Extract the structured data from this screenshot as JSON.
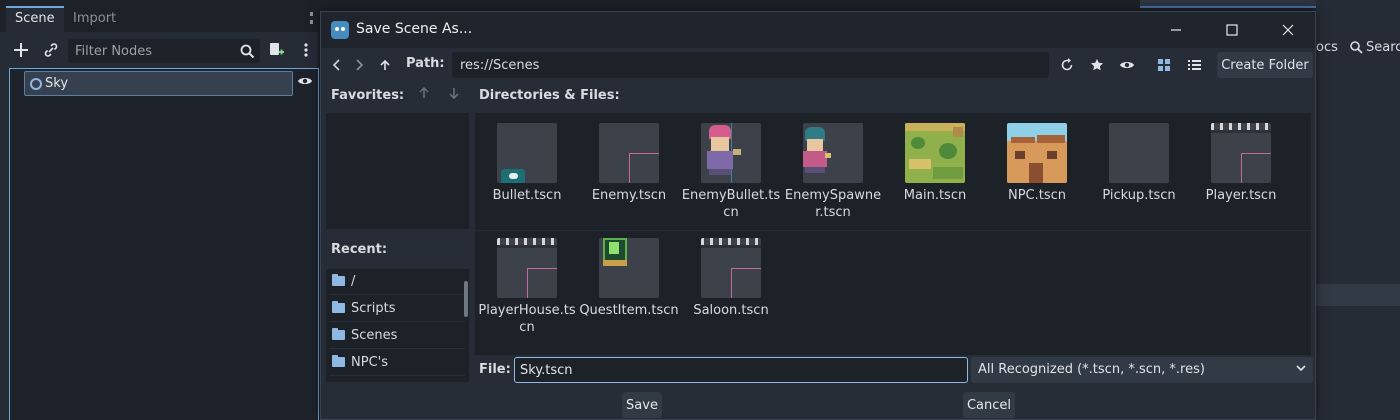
{
  "dock": {
    "tabs": [
      "Scene",
      "Import"
    ],
    "filter_placeholder": "Filter Nodes",
    "tree_root": "Sky"
  },
  "background": {
    "tab_docs": "ocs",
    "tab_search": "Searc"
  },
  "dialog": {
    "title": "Save Scene As...",
    "path_label": "Path:",
    "path_value": "res://Scenes",
    "create_folder_label": "Create Folder",
    "favorites_label": "Favorites:",
    "recent_label": "Recent:",
    "recent_items": [
      "/",
      "Scripts",
      "Scenes",
      "NPC's",
      "..."
    ],
    "files_label": "Directories & Files:",
    "files": [
      {
        "name": "Bullet.tscn",
        "thumb": "bullet"
      },
      {
        "name": "Enemy.tscn",
        "thumb": "empty"
      },
      {
        "name": "EnemyBullet.tscn",
        "thumb": "character"
      },
      {
        "name": "EnemySpawner.tscn",
        "thumb": "character2"
      },
      {
        "name": "Main.tscn",
        "thumb": "map"
      },
      {
        "name": "NPC.tscn",
        "thumb": "house"
      },
      {
        "name": "Pickup.tscn",
        "thumb": "blank"
      },
      {
        "name": "Player.tscn",
        "thumb": "tiles"
      },
      {
        "name": "PlayerHouse.tscn",
        "thumb": "tiles"
      },
      {
        "name": "QuestItem.tscn",
        "thumb": "item"
      },
      {
        "name": "Saloon.tscn",
        "thumb": "tiles"
      }
    ],
    "file_label": "File:",
    "file_value": "Sky.tscn",
    "filter_value": "All Recognized (*.tscn, *.scn, *.res)",
    "save_label": "Save",
    "cancel_label": "Cancel"
  },
  "colors": {
    "accent": "#6fa6d8",
    "panel": "#1d2229",
    "dialog_bg": "#272d37"
  }
}
